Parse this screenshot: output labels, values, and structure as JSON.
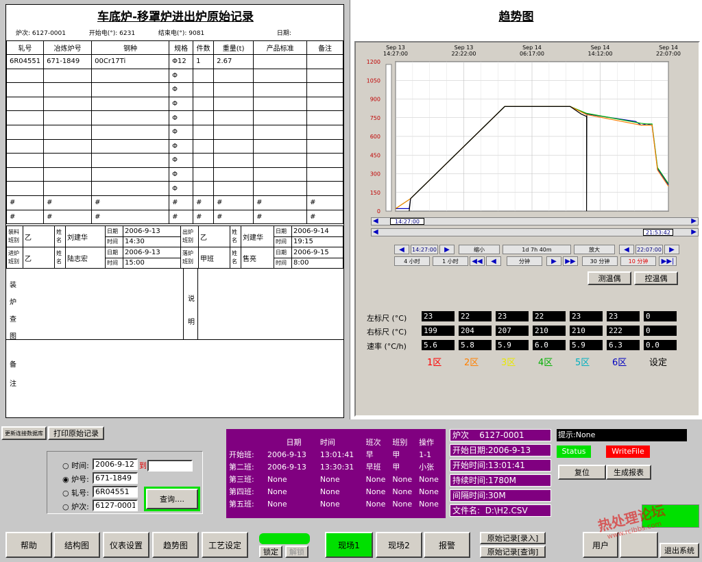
{
  "record": {
    "title": "车底炉-移罩炉进出炉原始记录",
    "furnace_label": "炉次:",
    "furnace_no": "6127-0001",
    "start_label": "开始电(°):",
    "start_val": "6231",
    "end_label": "结束电(°):",
    "end_val": "9081",
    "date_label": "日期:",
    "headers": [
      "轧号",
      "冶炼炉号",
      "钢种",
      "规格",
      "件数",
      "重量(t)",
      "产品标准",
      "备注"
    ],
    "row1": [
      "6R04551",
      "671-1849",
      "00Cr17Ti",
      "Φ12",
      "1",
      "2.67",
      "",
      ""
    ],
    "phi": "Φ",
    "hash": "#",
    "shift": {
      "in_shift_label": "装料班别",
      "in_shift": "乙",
      "name_label": "姓名",
      "in_name": "刘建华",
      "date_label": "日期",
      "time_label": "时间",
      "in_date": "2006-9-13",
      "in_time": "14:30",
      "out_shift_label": "出炉班别",
      "out_shift": "乙",
      "out_name": "刘建华",
      "out_date": "2006-9-14",
      "out_time": "19:15",
      "in2_shift_label": "进炉班别",
      "in2_shift": "乙",
      "in2_name": "陆志宏",
      "in2_date": "2006-9-13",
      "in2_time": "15:00",
      "out2_shift_label": "落炉班别",
      "out2_shift": "甲班",
      "out2_name": "售亮",
      "out2_date": "2006-9-15",
      "out2_time": "8:00"
    },
    "diagram_label": [
      "装",
      "炉",
      "查",
      "图"
    ],
    "desc_label": [
      "说",
      "明"
    ],
    "remark_label": [
      "备",
      "注"
    ]
  },
  "trend": {
    "title": "趋势图",
    "controls": {
      "t_start": "14:27:00",
      "t_end": "21:53:42",
      "nav_start": "14:27:00",
      "span_label": "缩小",
      "span_value": "1d 7h 40m",
      "zoom_label": "放大",
      "nav_end": "22:07:00",
      "btn_4h": "4 小时",
      "btn_1h": "1 小时",
      "minute": "分钟",
      "btn_30": "30 分钟",
      "btn_10": "10 分钟",
      "tc1": "测温偶",
      "tc2": "控温偶"
    },
    "scale": {
      "left_label": "左标尺 (°C)",
      "right_label": "右标尺 (°C)",
      "rate_label": "速率 (°C/h)",
      "left": [
        "23",
        "22",
        "23",
        "22",
        "23",
        "23",
        "0"
      ],
      "right": [
        "199",
        "204",
        "207",
        "210",
        "210",
        "222",
        "0"
      ],
      "rate": [
        "5.6",
        "5.8",
        "5.9",
        "6.0",
        "5.9",
        "6.3",
        "0.0"
      ],
      "zones": [
        "1区",
        "2区",
        "3区",
        "4区",
        "5区",
        "6区",
        "设定"
      ],
      "zone_colors": [
        "#ff0000",
        "#ff8000",
        "#e8e800",
        "#00b000",
        "#00b0c0",
        "#0000c0",
        "#000000"
      ]
    }
  },
  "chart_data": {
    "type": "line",
    "x_ticks": [
      {
        "date": "Sep 13",
        "time": "14:27:00"
      },
      {
        "date": "Sep 13",
        "time": "22:22:00"
      },
      {
        "date": "Sep 14",
        "time": "06:17:00"
      },
      {
        "date": "Sep 14",
        "time": "14:12:00"
      },
      {
        "date": "Sep 14",
        "time": "22:07:00"
      }
    ],
    "y_ticks": [
      0,
      150,
      300,
      450,
      600,
      750,
      900,
      1050,
      1200
    ],
    "ylim": [
      0,
      1200
    ],
    "grid": true,
    "series": [
      {
        "color": "#0000c0",
        "points": [
          [
            0,
            20
          ],
          [
            0.05,
            20
          ],
          [
            0.055,
            100
          ],
          [
            0.4,
            840
          ],
          [
            0.64,
            840
          ],
          [
            0.7,
            780
          ],
          [
            0.88,
            720
          ],
          [
            0.9,
            690
          ],
          [
            0.92,
            700
          ],
          [
            0.94,
            690
          ],
          [
            0.96,
            340
          ],
          [
            1,
            210
          ]
        ]
      },
      {
        "color": "#00b000",
        "points": [
          [
            0,
            20
          ],
          [
            0.055,
            100
          ],
          [
            0.4,
            840
          ],
          [
            0.64,
            840
          ],
          [
            0.7,
            785
          ],
          [
            0.9,
            705
          ],
          [
            0.92,
            700
          ],
          [
            0.94,
            700
          ],
          [
            0.96,
            350
          ],
          [
            1,
            220
          ]
        ]
      },
      {
        "color": "#ff8000",
        "points": [
          [
            0,
            20
          ],
          [
            0.055,
            100
          ],
          [
            0.4,
            840
          ],
          [
            0.64,
            840
          ],
          [
            0.7,
            775
          ],
          [
            0.9,
            690
          ],
          [
            0.94,
            690
          ],
          [
            0.96,
            330
          ],
          [
            1,
            200
          ]
        ]
      },
      {
        "color": "#000000",
        "points": [
          [
            0.05,
            0
          ],
          [
            0.055,
            100
          ],
          [
            0.4,
            840
          ],
          [
            0.64,
            840
          ],
          [
            0.68,
            780
          ],
          [
            0.7,
            760
          ],
          [
            0.7,
            0
          ],
          [
            0.701,
            770
          ]
        ]
      }
    ]
  },
  "bottom": {
    "update_btn": "更新连接数据库",
    "print_btn": "打印原始记录",
    "search": {
      "opt_time": "时间:",
      "time_from": "2006-9-12",
      "to_label": "到",
      "time_to": "",
      "opt_furnace": "炉号:",
      "furnace": "671-1849",
      "opt_roll": "轧号:",
      "roll": "6R04551",
      "opt_batch": "炉次:",
      "batch": "6127-0001",
      "query_btn": "查询...."
    },
    "shift_table": {
      "headers": [
        "",
        "日期",
        "时间",
        "班次",
        "班别",
        "操作"
      ],
      "rows": [
        [
          "开始班:",
          "2006-9-13",
          "13:01:41",
          "早",
          "甲",
          "1-1"
        ],
        [
          "第二班:",
          "2006-9-13",
          "13:30:31",
          "早班",
          "甲",
          "小张"
        ],
        [
          "第三班:",
          "None",
          "None",
          "None",
          "None",
          "None"
        ],
        [
          "第四班:",
          "None",
          "None",
          "None",
          "None",
          "None"
        ],
        [
          "第五班:",
          "None",
          "None",
          "None",
          "None",
          "None"
        ]
      ]
    },
    "info": {
      "batch_label": "炉次",
      "batch": "6127-0001",
      "start_date_label": "开始日期:",
      "start_date": "2006-9-13",
      "start_time_label": "开始时间:",
      "start_time": "13:01:41",
      "duration_label": "持续时间:",
      "duration": "1780M",
      "interval_label": "间隔时间:",
      "interval": "30M",
      "file_label": "文件名:",
      "file": "D:\\H2.CSV"
    },
    "hint_label": "提示:",
    "hint": "None",
    "status": "Status",
    "writefile": "WriteFile",
    "reset_btn": "复位",
    "report_btn": "生成报表",
    "lock_btn": "锁定",
    "unlock_btn": "解锁",
    "watermark": "热处理论坛",
    "watermark2": "www.rclbbs.com"
  },
  "nav": {
    "help": "帮助",
    "structure": "结构图",
    "instrument": "仪表设置",
    "trend": "趋势图",
    "process": "工艺设定",
    "site1": "现场1",
    "site2": "现场2",
    "alarm": "报警",
    "rec_entry": "原始记录[录入]",
    "rec_query": "原始记录[查询]",
    "user": "用户",
    "exit": "退出系统"
  }
}
